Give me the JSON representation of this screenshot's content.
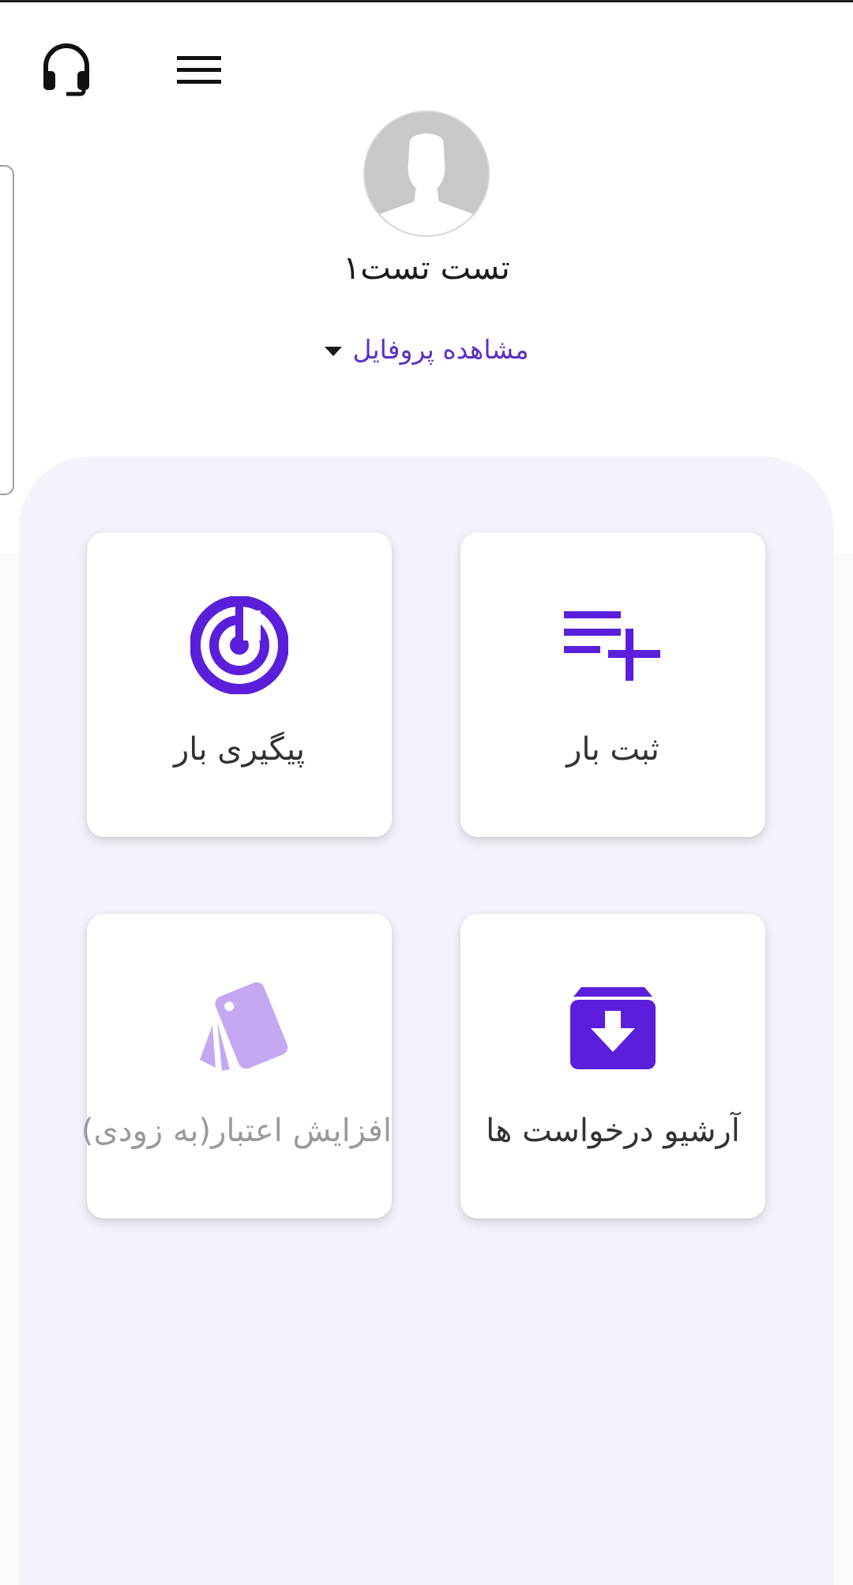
{
  "header": {
    "support_icon": "headset-icon",
    "menu_icon": "hamburger-menu-icon"
  },
  "profile": {
    "name": "تست تست۱",
    "view_profile_label": "مشاهده پروفایل",
    "avatar_icon": "user-silhouette-icon"
  },
  "colors": {
    "accent": "#5b1fdb",
    "accent_light": "#c4a8f1",
    "link": "#5b2fc9",
    "panel_bg": "#f3f4fb"
  },
  "cards": {
    "register": {
      "label": "ثبت بار",
      "icon": "playlist-add-icon",
      "enabled": true
    },
    "track": {
      "label": "پیگیری بار",
      "icon": "radar-tracking-icon",
      "enabled": true
    },
    "archive": {
      "label": "آرشیو درخواست ها",
      "icon": "archive-download-icon",
      "enabled": true
    },
    "credit": {
      "label": "افزایش اعتبار(به زودی)",
      "icon": "cards-icon",
      "enabled": false
    }
  }
}
